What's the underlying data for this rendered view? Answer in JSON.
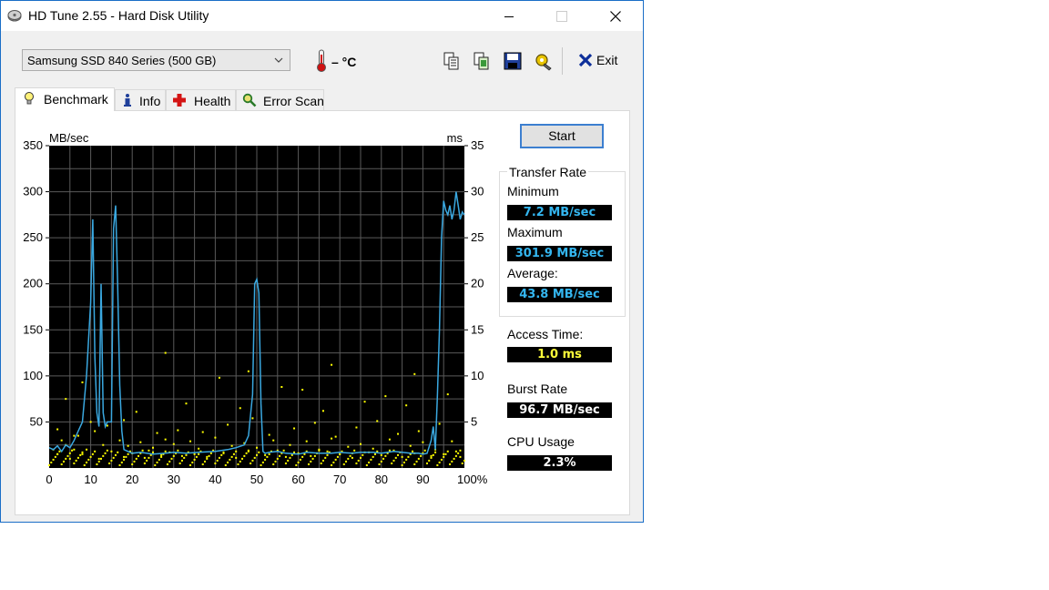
{
  "window": {
    "title": "HD Tune 2.55 - Hard Disk Utility"
  },
  "toolbar": {
    "drive": "Samsung SSD 840 Series (500 GB)",
    "temperature": "– °C",
    "icons": [
      "copy-text-icon",
      "copy-screen-icon",
      "save-icon",
      "options-icon"
    ],
    "exit_label": "Exit"
  },
  "tabs": [
    {
      "label": "Benchmark",
      "icon": "lightbulb-icon",
      "active": true
    },
    {
      "label": "Info",
      "icon": "info-icon",
      "active": false
    },
    {
      "label": "Health",
      "icon": "health-cross-icon",
      "active": false
    },
    {
      "label": "Error Scan",
      "icon": "magnifier-icon",
      "active": false
    }
  ],
  "benchmark": {
    "start_label": "Start",
    "transfer_rate_title": "Transfer Rate",
    "minimum_label": "Minimum",
    "minimum_value": "7.2 MB/sec",
    "maximum_label": "Maximum",
    "maximum_value": "301.9 MB/sec",
    "average_label": "Average:",
    "average_value": "43.8 MB/sec",
    "access_time_label": "Access Time:",
    "access_time_value": "1.0 ms",
    "burst_rate_label": "Burst Rate",
    "burst_rate_value": "96.7 MB/sec",
    "cpu_usage_label": "CPU Usage",
    "cpu_usage_value": "2.3%"
  },
  "colors": {
    "chart_bg": "#000000",
    "grid": "#5a5a5a",
    "transfer_line": "#3aa8e0",
    "access_dots": "#ffff00",
    "accent": "#1a6ec7"
  },
  "chart_data": {
    "type": "line",
    "y_left_label": "MB/sec",
    "y_right_label": "ms",
    "y_left_ticks": [
      "350",
      "300",
      "250",
      "200",
      "150",
      "100",
      "50"
    ],
    "y_right_ticks": [
      "35",
      "30",
      "25",
      "20",
      "15",
      "10",
      "5"
    ],
    "x_ticks": [
      "0",
      "10",
      "20",
      "30",
      "40",
      "50",
      "60",
      "70",
      "80",
      "90",
      "100%"
    ],
    "ylim": [
      0,
      350
    ],
    "y2lim": [
      0,
      35
    ],
    "xlim": [
      0,
      100
    ],
    "grid": true,
    "series": [
      {
        "type": "line",
        "x": [
          0,
          1,
          2,
          3,
          4,
          5,
          6,
          7,
          8,
          9,
          10,
          10.5,
          11,
          11.5,
          12,
          12.5,
          13,
          13.5,
          14,
          15,
          15.5,
          16,
          16.5,
          17,
          17.5,
          18,
          19,
          20,
          22,
          25,
          28,
          30,
          33,
          36,
          40,
          43,
          45,
          47,
          48,
          49,
          49.5,
          50,
          50.5,
          51,
          51.5,
          52,
          53,
          55,
          57,
          60,
          62,
          65,
          68,
          70,
          73,
          75,
          78,
          80,
          83,
          85,
          87,
          89,
          90,
          91,
          92,
          92.5,
          93,
          93.5,
          94,
          94.5,
          95,
          95.5,
          96,
          96.5,
          97,
          97.5,
          98,
          98.5,
          99,
          99.5,
          100
        ],
        "y": [
          22,
          20,
          24,
          18,
          25,
          22,
          30,
          40,
          50,
          100,
          180,
          270,
          120,
          60,
          45,
          200,
          60,
          45,
          50,
          50,
          260,
          285,
          200,
          90,
          40,
          20,
          18,
          16,
          17,
          15,
          16,
          17,
          16,
          17,
          18,
          20,
          22,
          25,
          35,
          80,
          200,
          205,
          190,
          70,
          18,
          16,
          17,
          18,
          16,
          15,
          17,
          16,
          16,
          17,
          16,
          17,
          17,
          16,
          18,
          17,
          16,
          16,
          15,
          16,
          30,
          45,
          20,
          80,
          150,
          250,
          290,
          280,
          275,
          285,
          270,
          280,
          300,
          285,
          270,
          278,
          275
        ]
      },
      {
        "type": "scatter",
        "name": "access",
        "x": [
          1,
          2,
          3,
          4,
          5,
          6,
          7,
          8,
          9,
          11,
          12,
          13,
          15,
          17,
          18,
          19,
          20,
          22,
          23,
          24,
          25,
          27,
          28,
          29,
          30,
          32,
          34,
          35,
          36,
          38,
          40,
          42,
          44,
          45,
          47,
          48,
          50,
          52,
          54,
          55,
          57,
          58,
          60,
          62,
          63,
          65,
          67,
          68,
          70,
          72,
          73,
          75,
          77,
          78,
          80,
          82,
          83,
          85,
          87,
          88,
          90,
          92,
          93,
          95,
          97,
          98,
          99,
          2,
          6,
          10,
          14,
          18,
          26,
          31,
          37,
          43,
          49,
          53,
          59,
          64,
          69,
          74,
          79,
          84,
          89,
          94,
          4,
          33,
          46,
          56,
          66,
          76,
          86,
          96,
          21,
          41,
          61,
          81,
          8,
          28,
          48,
          68,
          88
        ],
        "y": [
          2,
          1.5,
          3,
          2.5,
          1,
          2,
          3.5,
          1.5,
          2,
          4,
          1,
          2.5,
          1.8,
          3,
          1.2,
          2.4,
          1.6,
          2.8,
          1.1,
          1.9,
          2.2,
          1.4,
          3.1,
          1.7,
          2.6,
          1.3,
          2.9,
          1.5,
          2.1,
          1.2,
          3.3,
          1.6,
          2.4,
          1.1,
          2.7,
          1.8,
          2.2,
          1.4,
          3,
          1.9,
          1.2,
          2.5,
          1.6,
          2.9,
          1.3,
          2,
          1.8,
          3.2,
          1.5,
          2.3,
          1.1,
          2.6,
          1.7,
          2.1,
          1.4,
          3.1,
          1.9,
          1.2,
          2.4,
          1.6,
          2.8,
          1.3,
          2,
          1.5,
          2.9,
          1.8,
          1.2,
          4.2,
          3.5,
          5,
          4.6,
          5.2,
          3.8,
          4.1,
          3.9,
          4.7,
          5.4,
          3.6,
          4.3,
          4.9,
          3.4,
          4.4,
          5.1,
          3.7,
          4,
          4.8,
          7.5,
          7,
          6.5,
          8.8,
          6.2,
          7.2,
          6.8,
          8,
          6.1,
          9.8,
          8.5,
          7.8,
          9.3,
          12.5,
          10.5,
          11.2,
          10.2
        ]
      }
    ]
  }
}
